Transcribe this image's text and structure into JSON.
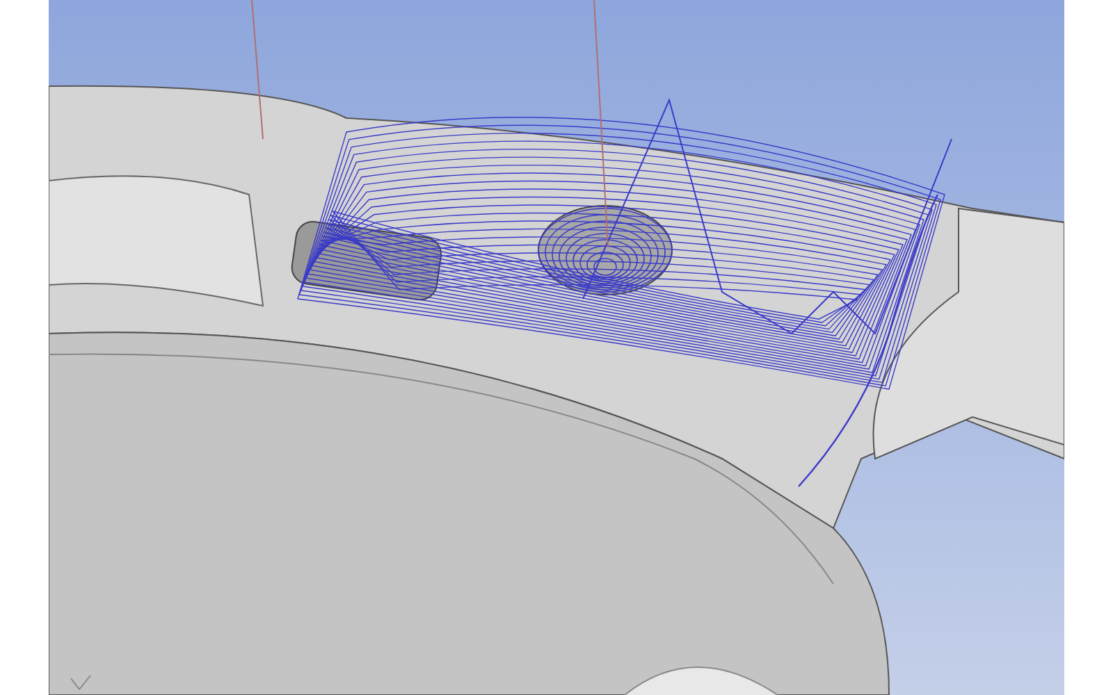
{
  "viewport": {
    "kind": "toolpath"
  }
}
